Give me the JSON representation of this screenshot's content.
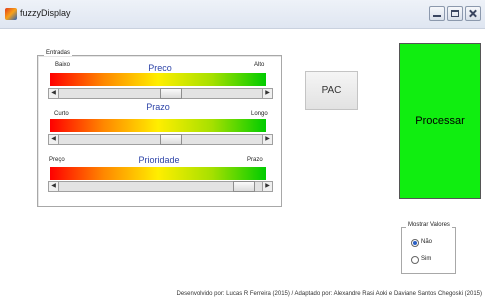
{
  "window": {
    "title": "fuzzyDisplay"
  },
  "entradas": {
    "legend": "Entradas",
    "preco": {
      "title": "Preco",
      "low": "Baixo",
      "high": "Alto",
      "value": 0.55
    },
    "prazo": {
      "title": "Prazo",
      "low": "Curto",
      "high": "Longo",
      "value": 0.55
    },
    "prioridade": {
      "title": "Prioridade",
      "low": "Preço",
      "high": "Prazo",
      "value": 0.95
    }
  },
  "buttons": {
    "pac": "PAC",
    "processar": "Processar"
  },
  "colors": {
    "processar_bg": "#10ee10",
    "accent": "#2d44a8"
  },
  "mostrar_valores": {
    "legend": "Mostrar Valores",
    "options": [
      "Não",
      "Sim"
    ],
    "selected": "Não"
  },
  "footer": "Desenvolvido por: Lucas R Ferreira (2015) / Adaptado por: Alexandre Rasi Aoki e Daviane Santos Chegoski (2015)"
}
